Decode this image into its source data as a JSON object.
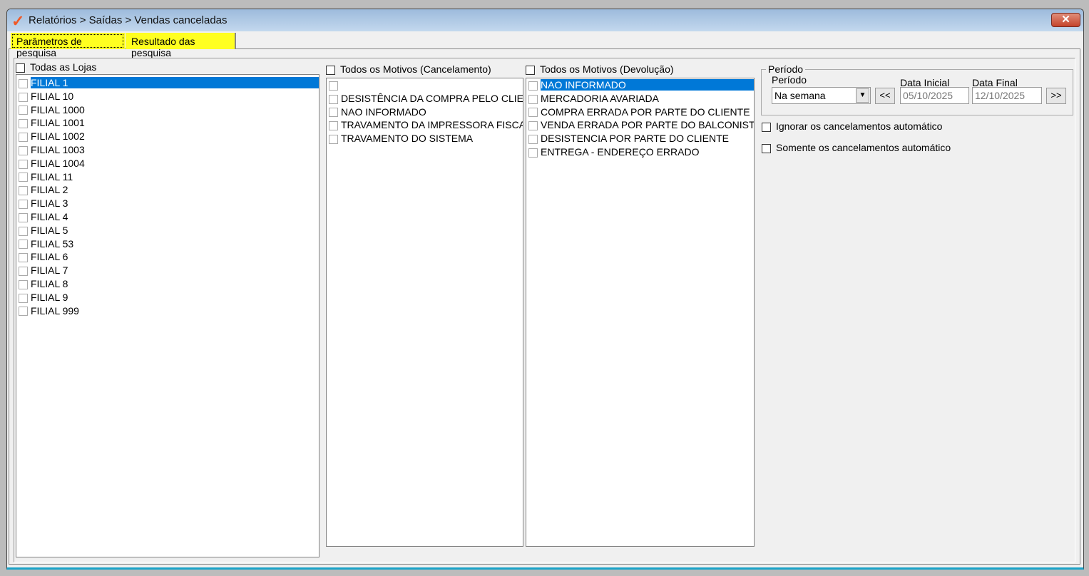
{
  "window": {
    "title": "Relatórios > Saídas > Vendas canceladas",
    "close_label": "✕"
  },
  "tabs": [
    {
      "label": "Parâmetros de pesquisa"
    },
    {
      "label": "Resultado das pesquisa"
    }
  ],
  "lojas": {
    "header": "Todas as Lojas",
    "items": [
      "FILIAL 1",
      "FILIAL 10",
      "FILIAL 1000",
      "FILIAL 1001",
      "FILIAL 1002",
      "FILIAL 1003",
      "FILIAL 1004",
      "FILIAL 11",
      "FILIAL 2",
      "FILIAL 3",
      "FILIAL 4",
      "FILIAL 5",
      "FILIAL 53",
      "FILIAL 6",
      "FILIAL 7",
      "FILIAL 8",
      "FILIAL 9",
      "FILIAL 999"
    ]
  },
  "cancelamento": {
    "header": "Todos os Motivos (Cancelamento)",
    "items": [
      "",
      "DESISTÊNCIA DA COMPRA PELO CLIENTE",
      "NAO INFORMADO",
      "TRAVAMENTO DA IMPRESSORA FISCAL",
      "TRAVAMENTO DO SISTEMA"
    ]
  },
  "devolucao": {
    "header": "Todos os Motivos (Devolução)",
    "items": [
      "NAO INFORMADO",
      "MERCADORIA AVARIADA",
      "COMPRA ERRADA POR PARTE DO CLIENTE",
      "VENDA ERRADA POR PARTE DO BALCONISTA",
      "DESISTENCIA POR PARTE DO CLIENTE",
      "ENTREGA - ENDEREÇO ERRADO"
    ]
  },
  "periodo": {
    "group_label": "Período",
    "label": "Período",
    "value": "Na semana",
    "prev": "<<",
    "next": ">>",
    "data_inicial_label": "Data Inicial",
    "data_inicial": "05/10/2025",
    "data_final_label": "Data Final",
    "data_final": "12/10/2025"
  },
  "options": {
    "ignorar": "Ignorar os cancelamentos automático",
    "somente": "Somente os cancelamentos automático"
  }
}
